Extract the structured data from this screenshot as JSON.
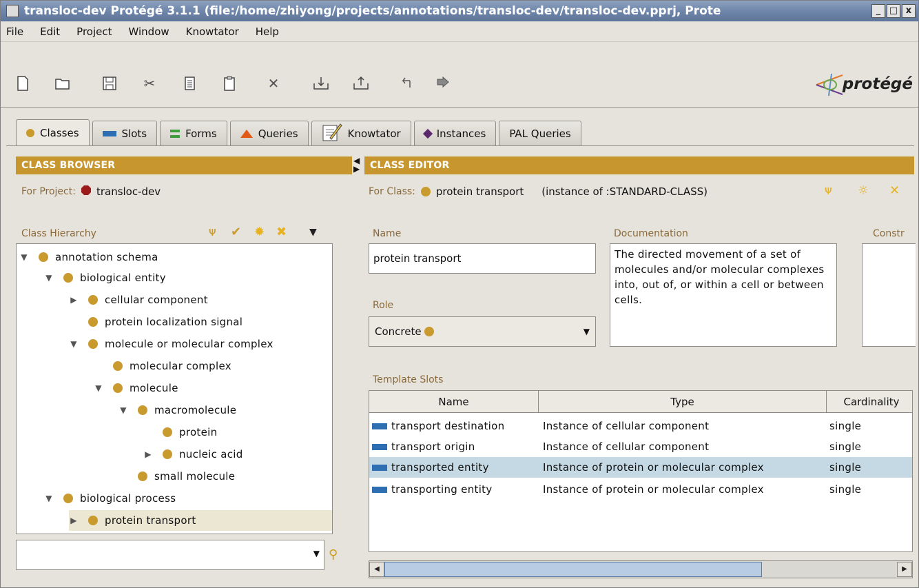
{
  "window": {
    "title": "transloc-dev  Protégé 3.1.1     (file:/home/zhiyong/projects/annotations/transloc-dev/transloc-dev.pprj, Prote",
    "controls": [
      "_",
      "□",
      "x"
    ]
  },
  "menu": [
    {
      "label": "File"
    },
    {
      "label": "Edit"
    },
    {
      "label": "Project"
    },
    {
      "label": "Window"
    },
    {
      "label": "Knowtator"
    },
    {
      "label": "Help"
    }
  ],
  "toolbar": {
    "icons": [
      "new-file-icon",
      "open-folder-icon",
      "save-icon",
      "cut-icon",
      "copy-icon",
      "paste-icon",
      "delete-icon",
      "import-icon",
      "export-icon",
      "undo-icon",
      "redo-icon"
    ],
    "logo_text": "protégé"
  },
  "tabs": [
    {
      "label": "Classes",
      "icon": "class-dot-icon"
    },
    {
      "label": "Slots",
      "icon": "slot-bar-icon"
    },
    {
      "label": "Forms",
      "icon": "forms-icon"
    },
    {
      "label": "Queries",
      "icon": "queries-icon"
    },
    {
      "label": "Knowtator",
      "icon": "knowtator-icon"
    },
    {
      "label": "Instances",
      "icon": "instance-diamond-icon"
    },
    {
      "label": "PAL Queries",
      "icon": ""
    }
  ],
  "browser": {
    "header": "CLASS BROWSER",
    "for_project_label": "For Project:",
    "project_name": "transloc-dev",
    "hierarchy_label": "Class Hierarchy",
    "tree": [
      {
        "label": "annotation schema",
        "toggle": "▼"
      },
      {
        "label": "biological entity",
        "toggle": "▼"
      },
      {
        "label": "cellular component",
        "toggle": "▶"
      },
      {
        "label": "protein localization signal",
        "toggle": ""
      },
      {
        "label": "molecule or molecular complex",
        "toggle": "▼"
      },
      {
        "label": "molecular complex",
        "toggle": ""
      },
      {
        "label": "molecule",
        "toggle": "▼"
      },
      {
        "label": "macromolecule",
        "toggle": "▼"
      },
      {
        "label": "protein",
        "toggle": ""
      },
      {
        "label": "nucleic acid",
        "toggle": "▶"
      },
      {
        "label": "small molecule",
        "toggle": ""
      },
      {
        "label": "biological process",
        "toggle": "▼"
      },
      {
        "label": "protein transport",
        "toggle": "▶"
      }
    ],
    "search_value": ""
  },
  "editor": {
    "header": "CLASS EDITOR",
    "for_class_label": "For Class:",
    "class_name": "protein transport",
    "instance_of": "(instance of :STANDARD-CLASS)",
    "name_label": "Name",
    "name_value": "protein transport",
    "role_label": "Role",
    "role_value": "Concrete",
    "documentation_label": "Documentation",
    "documentation_value": "The directed movement of a set of molecules and/or molecular complexes into, out of, or within a cell or between cells.",
    "constraints_label": "Constr",
    "template_slots_label": "Template Slots",
    "slot_columns": [
      "Name",
      "Type",
      "Cardinality"
    ],
    "slots": [
      {
        "name": "transport destination",
        "type": "Instance of cellular component",
        "cardinality": "single"
      },
      {
        "name": "transport origin",
        "type": "Instance of cellular component",
        "cardinality": "single"
      },
      {
        "name": "transported entity",
        "type": "Instance of protein or molecular complex",
        "cardinality": "single"
      },
      {
        "name": "transporting entity",
        "type": "Instance of protein or molecular complex",
        "cardinality": "single"
      }
    ],
    "selected_slot": "transported entity"
  },
  "colors": {
    "panel_header": "#c7962e",
    "class_dot": "#c99a2e",
    "slot_bar": "#2e6fb3",
    "selection_row": "#c5d9e4"
  }
}
